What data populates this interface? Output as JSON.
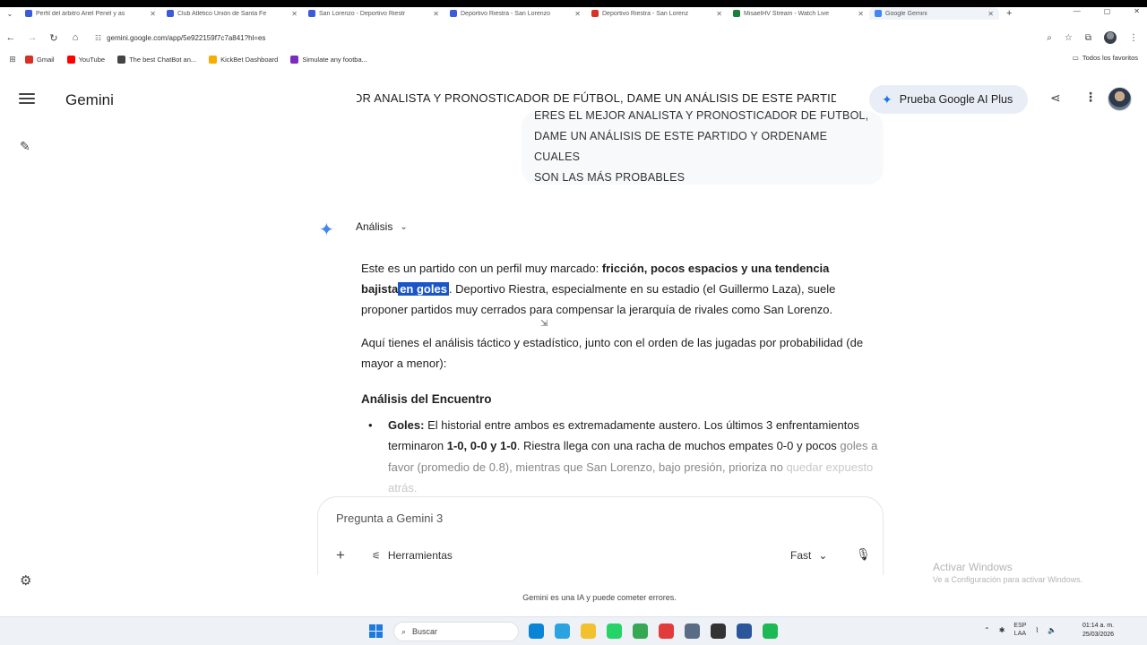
{
  "browser": {
    "tabs": [
      {
        "label": "Perfil del árbitro Ariel Penel y as",
        "color": "#3b5bdb"
      },
      {
        "label": "Club Atlético Unión de Santa Fe",
        "color": "#3b5bdb"
      },
      {
        "label": "San Lorenzo - Deportivo Riestr",
        "color": "#3b5bdb"
      },
      {
        "label": "Deportivo Riestra - San Lorenzo",
        "color": "#3b5bdb"
      },
      {
        "label": "Deportivo Riestra - San Lorenz",
        "color": "#d93025"
      },
      {
        "label": "MisaelHV Stream - Watch Live",
        "color": "#188038"
      },
      {
        "label": "Google Gemini",
        "color": "#4285f4"
      }
    ],
    "url": "gemini.google.com/app/5e922159f7c7a841?hl=es",
    "bookmarks": [
      {
        "label": "Gmail",
        "color": "#d93025"
      },
      {
        "label": "YouTube",
        "color": "#ff0000"
      },
      {
        "label": "The best ChatBot an...",
        "color": "#444444"
      },
      {
        "label": "KickBet Dashboard",
        "color": "#f9ab00"
      },
      {
        "label": "Simulate any footba...",
        "color": "#7b2cbf"
      }
    ],
    "bookmarks_right": "Todos los favoritos"
  },
  "app": {
    "brand": "Gemini",
    "chat_title": "ERES EL MEJOR ANALISTA Y PRONOSTICADOR DE FÚTBOL, DAME UN ANÁLISIS DE ESTE PARTIDO Y ORDENAME CUALES SON LAS MÁS PROBABLES",
    "plus_button": "Prueba Google AI Plus",
    "user_message": {
      "line1": "ERES EL MEJOR ANALISTA Y PRONOSTICADOR DE FÚTBOL,",
      "line2": "DAME UN ANÁLISIS DE ESTE PARTIDO Y ORDENAME CUALES",
      "line3": "SON LAS MÁS PROBABLES"
    },
    "response": {
      "mode_label": "Análisis",
      "p1_a": "Este es un partido con un perfil muy marcado: ",
      "p1_b": "fricción, pocos espacios y una tendencia bajista",
      "p1_hl": "en goles",
      "p1_c": ". Deportivo Riestra, especialmente en su estadio (el Guillermo Laza), suele proponer partidos muy cerrados para compensar la jerarquía de rivales como San Lorenzo.",
      "p2": "Aquí tienes el análisis táctico y estadístico, junto con el orden de las jugadas por probabilidad (de mayor a menor):",
      "h3": "Análisis del Encuentro",
      "b1_label": "Goles:",
      "b1_a": " El historial entre ambos es extremadamente austero. Los últimos 3 enfrentamientos terminaron ",
      "b1_scores": "1-0, 0-0 y 1-0",
      "b1_b": ". Riestra llega con una racha de muchos empates 0-0 y pocos ",
      "b1_fade": "goles a favor (promedio de 0.8), mientras que San Lorenzo, bajo presión, prioriza no",
      "b1_fade2": "quedar expuesto atrás."
    },
    "input": {
      "placeholder": "Pregunta a Gemini 3",
      "tools_label": "Herramientas",
      "model_label": "Fast"
    },
    "disclaimer": "Gemini es una IA y puede cometer errores."
  },
  "watermark": {
    "line1": "Activar Windows",
    "line2": "Ve a Configuración para activar Windows."
  },
  "taskbar": {
    "search_placeholder": "Buscar",
    "lang_line1": "ESP",
    "lang_line2": "LAA",
    "time": "01:14 a. m.",
    "date": "25/03/2026",
    "apps": [
      {
        "name": "edge",
        "color": "#0a84d6"
      },
      {
        "name": "telegram",
        "color": "#2aa3e0"
      },
      {
        "name": "files",
        "color": "#f2c12e"
      },
      {
        "name": "whatsapp",
        "color": "#25d366"
      },
      {
        "name": "chrome",
        "color": "#34a853"
      },
      {
        "name": "typora",
        "color": "#e23b3b"
      },
      {
        "name": "calculator",
        "color": "#5a6b85"
      },
      {
        "name": "app",
        "color": "#333333"
      },
      {
        "name": "word",
        "color": "#2b579a"
      },
      {
        "name": "spotify",
        "color": "#1db954"
      }
    ]
  }
}
